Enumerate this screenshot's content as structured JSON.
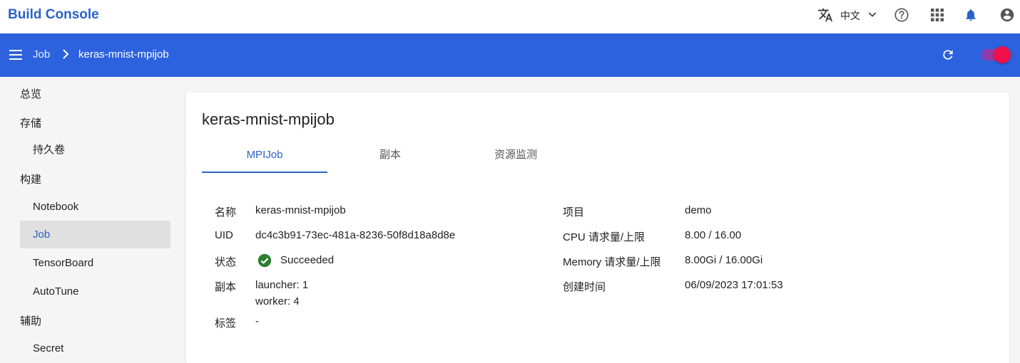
{
  "header": {
    "brand": "Build Console",
    "language": "中文",
    "icons": [
      "translate-icon",
      "chevron-down-icon",
      "help-icon",
      "apps-icon",
      "bell-icon",
      "account-icon"
    ],
    "bell_color": "#2a62c7"
  },
  "toolbar": {
    "background": "#2d62df",
    "breadcrumb_root": "Job",
    "breadcrumb_current": "keras-mnist-mpijob"
  },
  "sidebar": {
    "items": [
      {
        "type": "group",
        "label": "总览"
      },
      {
        "type": "group",
        "label": "存储"
      },
      {
        "type": "item",
        "label": "持久卷"
      },
      {
        "type": "group",
        "label": "构建"
      },
      {
        "type": "item",
        "label": "Notebook"
      },
      {
        "type": "item",
        "label": "Job",
        "active": true
      },
      {
        "type": "item",
        "label": "TensorBoard"
      },
      {
        "type": "item",
        "label": "AutoTune"
      },
      {
        "type": "group",
        "label": "辅助"
      },
      {
        "type": "item",
        "label": "Secret"
      }
    ]
  },
  "main": {
    "title": "keras-mnist-mpijob",
    "tabs": [
      "MPIJob",
      "副本",
      "资源监测"
    ],
    "active_tab": "MPIJob",
    "details_left": {
      "name_label": "名称",
      "name_value": "keras-mnist-mpijob",
      "uid_label": "UID",
      "uid_value": "dc4c3b91-73ec-481a-8236-50f8d18a8d8e",
      "status_label": "状态",
      "status_value": "Succeeded",
      "replicas_label": "副本",
      "replicas_launcher": "launcher: 1",
      "replicas_worker": "worker: 4",
      "tags_label": "标签",
      "tags_value": "-"
    },
    "details_right": {
      "project_label": "项目",
      "project_value": "demo",
      "cpu_label": "CPU 请求量/上限",
      "cpu_value": "8.00 / 16.00",
      "memory_label": "Memory 请求量/上限",
      "memory_value": "8.00Gi / 16.00Gi",
      "created_label": "创建时间",
      "created_value": "06/09/2023 17:01:53"
    },
    "status_color": "#2e7d32"
  }
}
